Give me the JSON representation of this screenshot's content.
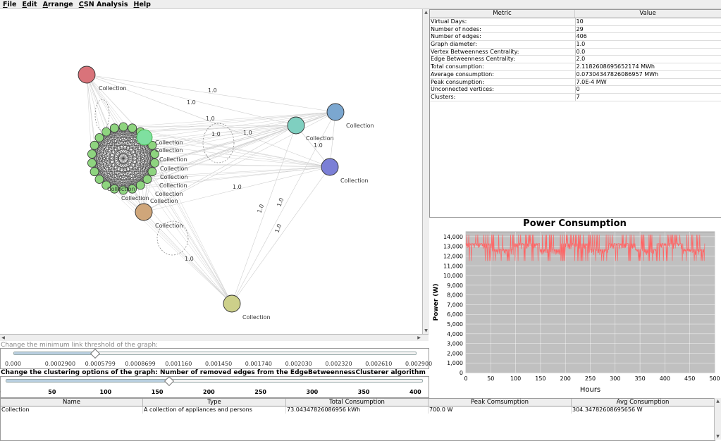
{
  "menu": {
    "items": [
      "File",
      "Edit",
      "Arrange",
      "CSN Analysis",
      "Help"
    ]
  },
  "graph": {
    "node_label": "Collection",
    "edge_label": "1.0",
    "colors": {
      "red": "#d9737a",
      "teal": "#7fcfc0",
      "blue": "#7ba7d0",
      "violet": "#7b7fd6",
      "tan": "#cfa67a",
      "olive": "#cdd08a",
      "green": "#8ed47f",
      "highlight": "#7fe0a0"
    }
  },
  "threshold": {
    "label": "Change the minimum link threshold of the graph:",
    "ticks": [
      "0.000",
      "0.0002900",
      "0.0005799",
      "0.0008699",
      "0.001160",
      "0.001450",
      "0.001740",
      "0.002030",
      "0.002320",
      "0.002610",
      "0.002900"
    ],
    "value_fraction": 0.2
  },
  "clustering": {
    "label": "Change the clustering options of the graph: Number of removed edges from the EdgeBetweennessClusterer algorithm",
    "ticks": [
      "0",
      "50",
      "100",
      "150",
      "200",
      "250",
      "300",
      "350",
      "400"
    ],
    "value": 160,
    "max": 400
  },
  "metrics": {
    "headers": {
      "metric": "Metric",
      "value": "Value"
    },
    "rows": [
      {
        "metric": "Virtual Days:",
        "value": "10"
      },
      {
        "metric": "Number of nodes:",
        "value": "29"
      },
      {
        "metric": "Number of edges:",
        "value": "406"
      },
      {
        "metric": "Graph diameter:",
        "value": "1.0"
      },
      {
        "metric": "Vertex Betweenness Centrality:",
        "value": "0.0"
      },
      {
        "metric": "Edge Betweenness Centrality:",
        "value": "2.0"
      },
      {
        "metric": "Total consumption:",
        "value": "2.1182608695652174 MWh"
      },
      {
        "metric": "Average consumption:",
        "value": "0.07304347826086957 MWh"
      },
      {
        "metric": "Peak consumption:",
        "value": "7.0E-4 MW"
      },
      {
        "metric": "Unconnected vertices:",
        "value": "0"
      },
      {
        "metric": "Clusters:",
        "value": "7"
      }
    ]
  },
  "chart_data": {
    "type": "line",
    "title": "Power Consumption",
    "xlabel": "Hours",
    "ylabel": "Power (W)",
    "xlim": [
      0,
      500
    ],
    "ylim": [
      0,
      14500
    ],
    "xticks": [
      "0",
      "50",
      "100",
      "150",
      "200",
      "250",
      "300",
      "350",
      "400",
      "450",
      "500"
    ],
    "yticks": [
      "0",
      "1,000",
      "2,000",
      "3,000",
      "4,000",
      "5,000",
      "6,000",
      "7,000",
      "8,000",
      "9,000",
      "10,000",
      "11,000",
      "12,000",
      "13,000",
      "14,000"
    ],
    "series_color": "#ff6464",
    "background": "#c0c0c0",
    "grid": true,
    "series": [
      {
        "x_start": 0,
        "x_end": 480,
        "min": 11500,
        "max": 14200,
        "cycle_hours": 96
      }
    ]
  },
  "bottom_table": {
    "headers": [
      "Name",
      "Type",
      "Total Consumption",
      "Peak Comsumption",
      "Avg Consumption"
    ],
    "rows": [
      [
        "Collection",
        "A collection of appliances and persons",
        "73.04347826086956 kWh",
        "700.0 W",
        "304.34782608695656 W"
      ]
    ]
  }
}
